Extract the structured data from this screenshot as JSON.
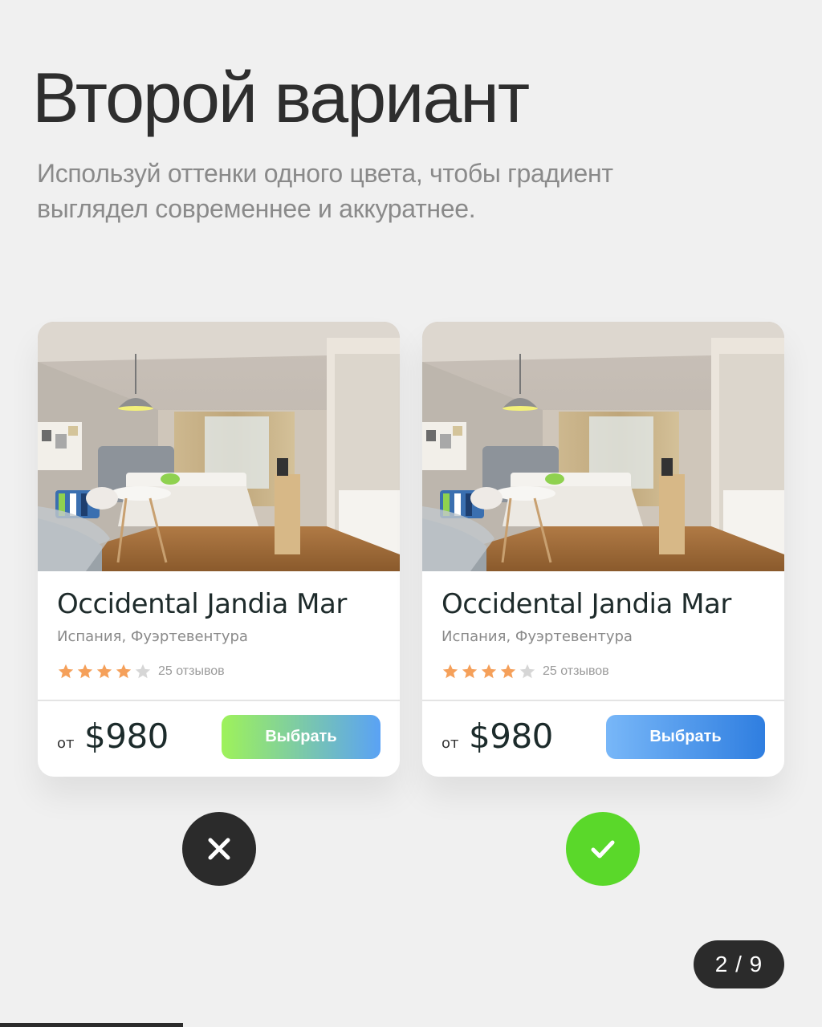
{
  "slide": {
    "title": "Второй вариант",
    "subtitle": "Используй оттенки одного цвета, чтобы градиент выглядел современнее и аккуратнее.",
    "page_indicator": "2 / 9",
    "progress": 0.2222
  },
  "cards": [
    {
      "variant": "bad",
      "hotel_name": "Occidental Jandia Mar",
      "location": "Испания, Фуэртевентура",
      "rating": 4,
      "rating_max": 5,
      "reviews": "25 отзывов",
      "price_prefix": "от",
      "price": "$980",
      "button_label": "Выбрать",
      "button_gradient": [
        "#9ef25a",
        "#5aa2f5"
      ],
      "verdict_icon": "close-icon",
      "verdict_color": "#2b2b2b"
    },
    {
      "variant": "good",
      "hotel_name": "Occidental Jandia Mar",
      "location": "Испания, Фуэртевентура",
      "rating": 4,
      "rating_max": 5,
      "reviews": "25 отзывов",
      "price_prefix": "от",
      "price": "$980",
      "button_label": "Выбрать",
      "button_gradient": [
        "#78b7f8",
        "#2f7ee0"
      ],
      "verdict_icon": "check-icon",
      "verdict_color": "#5ad82a"
    }
  ],
  "colors": {
    "background": "#f0f0f0",
    "star_filled": "#f5a05a",
    "star_empty": "#d6d6d6"
  }
}
